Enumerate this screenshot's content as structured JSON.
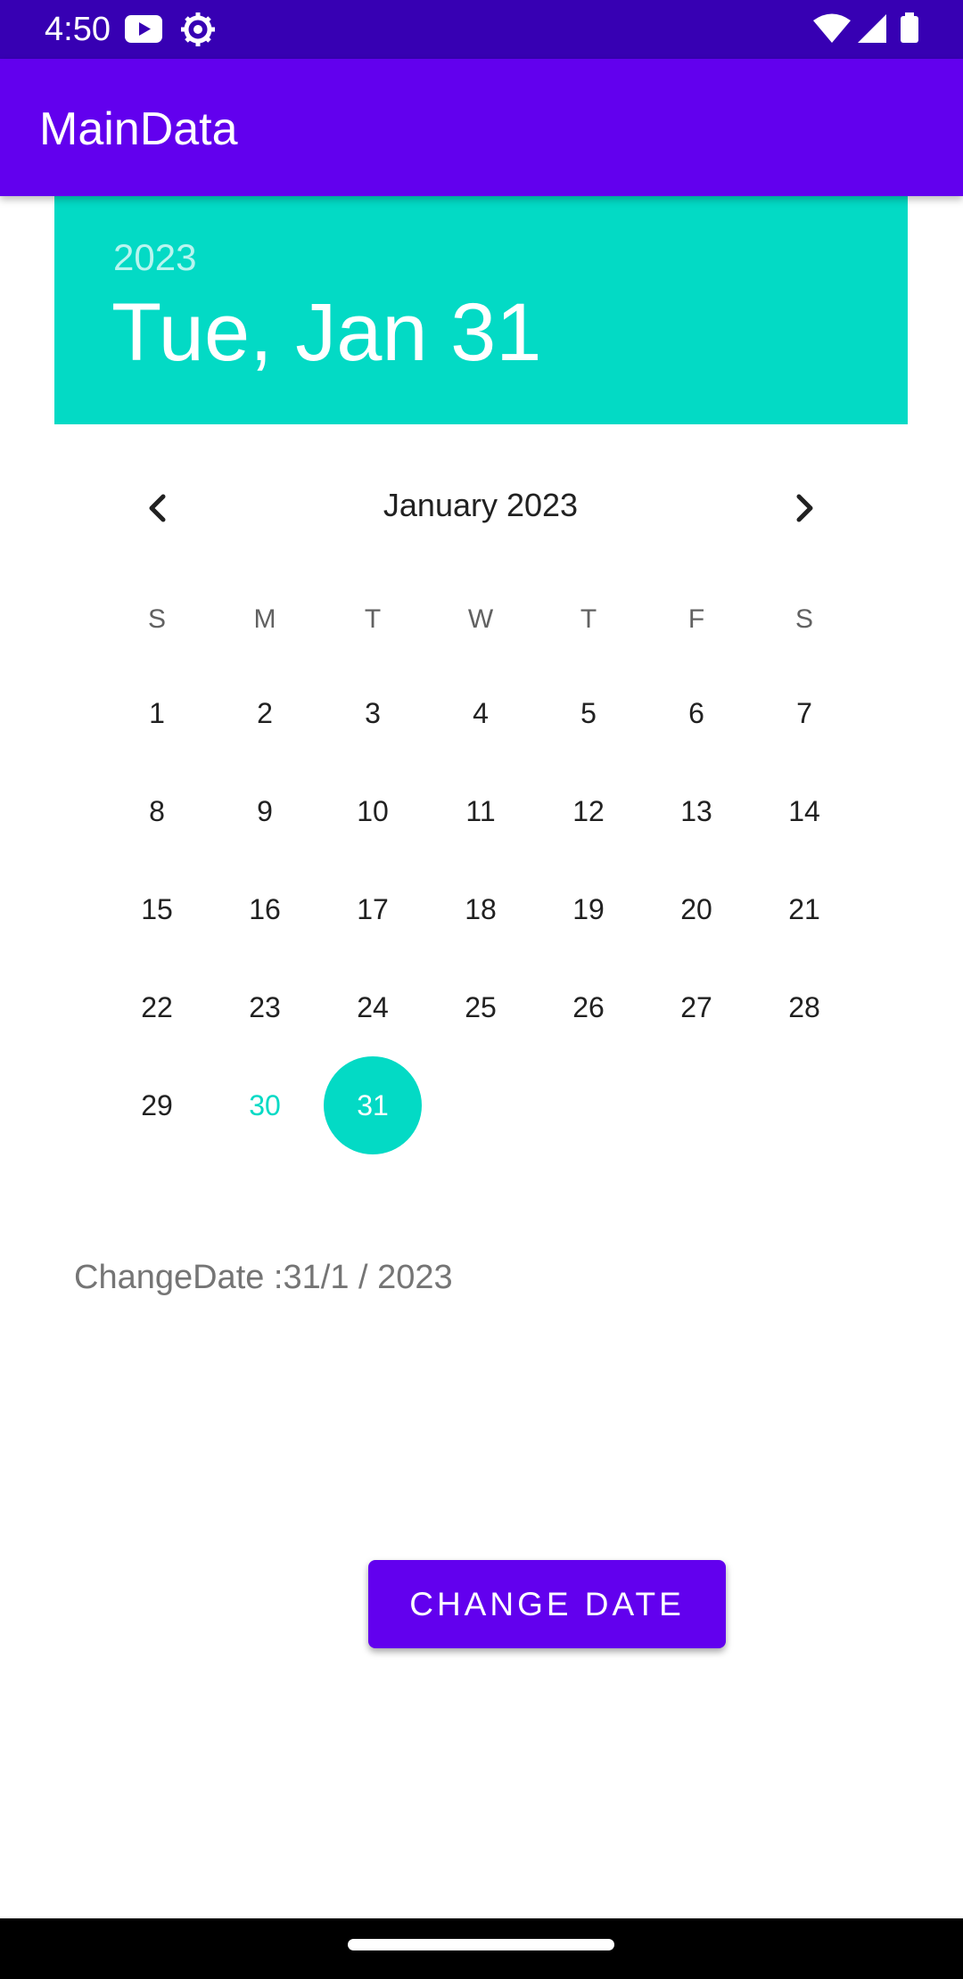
{
  "status_bar": {
    "time": "4:50",
    "left_icons": [
      "youtube-icon",
      "settings-gear-icon"
    ],
    "right_icons": [
      "wifi-icon",
      "cell-signal-icon",
      "battery-icon"
    ]
  },
  "app_bar": {
    "title": "MainData",
    "color": "#6200ee"
  },
  "date_picker": {
    "header_color": "#03dac5",
    "year": "2023",
    "selected_date_label": "Tue, Jan 31",
    "month_label": "January 2023",
    "prev_icon": "chevron-left-icon",
    "next_icon": "chevron-right-icon",
    "weekdays": [
      "S",
      "M",
      "T",
      "W",
      "T",
      "F",
      "S"
    ],
    "weeks": [
      [
        "1",
        "2",
        "3",
        "4",
        "5",
        "6",
        "7"
      ],
      [
        "8",
        "9",
        "10",
        "11",
        "12",
        "13",
        "14"
      ],
      [
        "15",
        "16",
        "17",
        "18",
        "19",
        "20",
        "21"
      ],
      [
        "22",
        "23",
        "24",
        "25",
        "26",
        "27",
        "28"
      ],
      [
        "29",
        "30",
        "31"
      ]
    ],
    "today": "30",
    "selected": "31"
  },
  "main": {
    "change_date_text": "ChangeDate :31/1 / 2023",
    "change_button_label": "CHANGE DATE"
  }
}
